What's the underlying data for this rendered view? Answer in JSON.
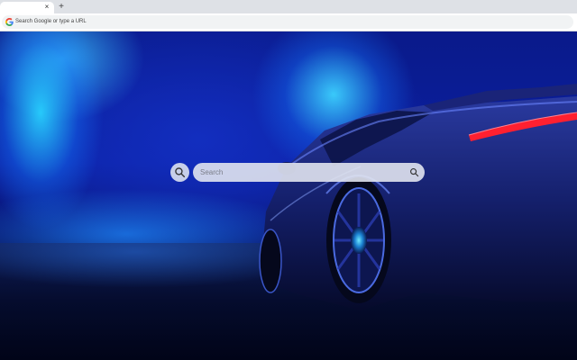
{
  "browser": {
    "tab_close_glyph": "×",
    "new_tab_glyph": "+",
    "omnibox": {
      "placeholder": "Search Google or type a URL",
      "icon": "google-g-icon"
    }
  },
  "page": {
    "background": "dark-blue-sports-car-wallpaper",
    "search": {
      "placeholder": "Search",
      "logo_icon": "magnifier-icon",
      "button_icon": "magnifier-icon"
    }
  },
  "colors": {
    "accent_blue": "#1e5cff",
    "glow_cyan": "#30d0ff",
    "taillight_red": "#ff2030"
  }
}
